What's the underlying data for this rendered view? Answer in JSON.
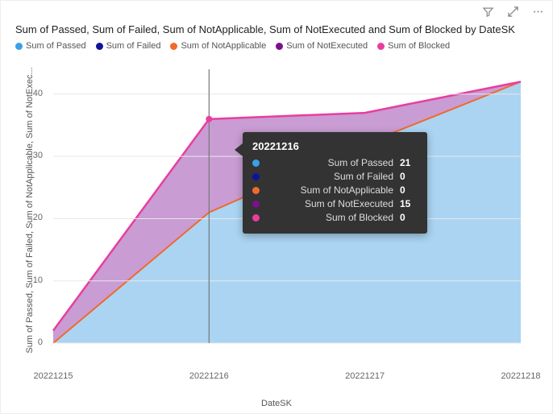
{
  "visual_actions": {
    "filter": "Filter",
    "focus": "Focus mode",
    "more": "More options"
  },
  "title": "Sum of Passed, Sum of Failed, Sum of NotApplicable, Sum of NotExecuted and Sum of Blocked by DateSK",
  "legend": [
    {
      "label": "Sum of Passed",
      "color": "#3aa0e8"
    },
    {
      "label": "Sum of Failed",
      "color": "#10129c"
    },
    {
      "label": "Sum of NotApplicable",
      "color": "#f06a2c"
    },
    {
      "label": "Sum of NotExecuted",
      "color": "#7d0f8c"
    },
    {
      "label": "Sum of Blocked",
      "color": "#e83ea0"
    }
  ],
  "axes": {
    "xlabel": "DateSK",
    "ylabel": "Sum of Passed, Sum of Failed, Sum of NotApplicable, Sum of NotExec..."
  },
  "tooltip": {
    "title": "20221216",
    "rows": [
      {
        "label": "Sum of Passed",
        "value": "21",
        "color": "#3aa0e8"
      },
      {
        "label": "Sum of Failed",
        "value": "0",
        "color": "#10129c"
      },
      {
        "label": "Sum of NotApplicable",
        "value": "0",
        "color": "#f06a2c"
      },
      {
        "label": "Sum of NotExecuted",
        "value": "15",
        "color": "#7d0f8c"
      },
      {
        "label": "Sum of Blocked",
        "value": "0",
        "color": "#e83ea0"
      }
    ]
  },
  "chart_data": {
    "type": "area",
    "stacked": true,
    "xlabel": "DateSK",
    "ylabel": "Sum of Passed, Sum of Failed, Sum of NotApplicable, Sum of NotExecuted and Sum of Blocked",
    "ylim": [
      0,
      44
    ],
    "yticks": [
      0,
      10,
      20,
      30,
      40
    ],
    "categories": [
      "20221215",
      "20221216",
      "20221217",
      "20221218"
    ],
    "series": [
      {
        "name": "Sum of Passed",
        "color": "#3aa0e8",
        "values": [
          0,
          21,
          32,
          42
        ]
      },
      {
        "name": "Sum of Failed",
        "color": "#10129c",
        "values": [
          0,
          0,
          0,
          0
        ]
      },
      {
        "name": "Sum of NotApplicable",
        "color": "#f06a2c",
        "values": [
          0,
          0,
          0,
          0
        ]
      },
      {
        "name": "Sum of NotExecuted",
        "color": "#7d0f8c",
        "values": [
          2,
          15,
          5,
          0
        ]
      },
      {
        "name": "Sum of Blocked",
        "color": "#e83ea0",
        "values": [
          0,
          0,
          0,
          0
        ]
      }
    ],
    "highlighted_category": "20221216",
    "colors": {
      "passed_fill": "#aad4f2",
      "notexecuted_fill": "#c99cd3",
      "top_line": "#e83ea0",
      "split_line": "#f06a2c"
    }
  }
}
